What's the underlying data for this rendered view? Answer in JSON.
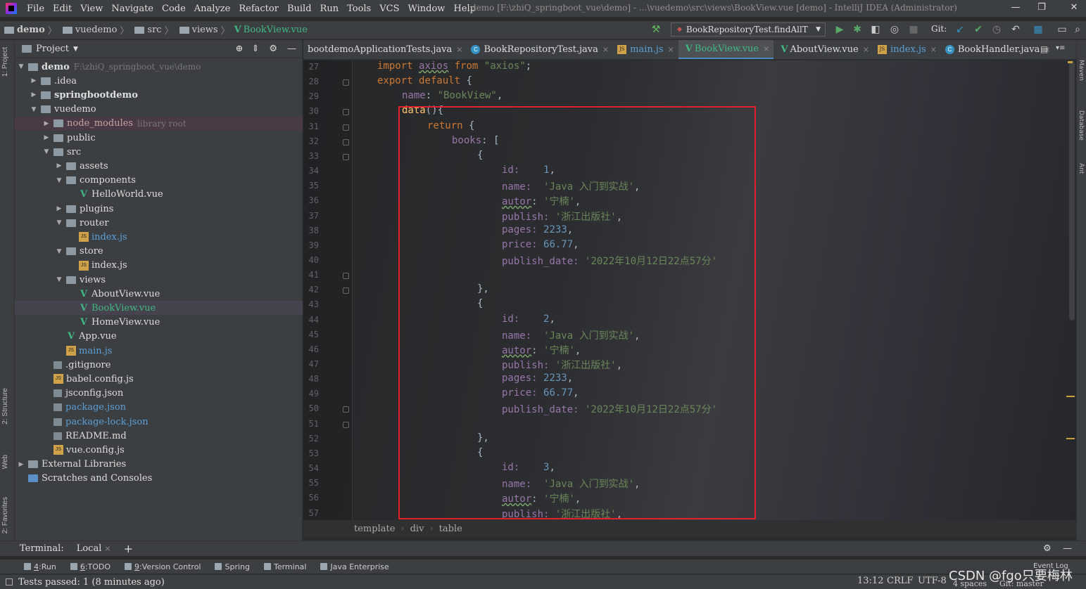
{
  "menu": [
    "File",
    "Edit",
    "View",
    "Navigate",
    "Code",
    "Analyze",
    "Refactor",
    "Build",
    "Run",
    "Tools",
    "VCS",
    "Window",
    "Help"
  ],
  "window_title": "demo [F:\\zhiQ_springboot_vue\\demo] - ...\\vuedemo\\src\\views\\BookView.vue [demo] - IntelliJ IDEA (Administrator)",
  "nav_breadcrumb": [
    "demo",
    "vuedemo",
    "src",
    "views",
    "BookView.vue"
  ],
  "run_config": "BookRepositoryTest.findAllT",
  "git_label": "Git:",
  "project_panel": {
    "title": "Project",
    "tree": [
      {
        "label": "demo",
        "note": "F:\\zhiQ_springboot_vue\\demo",
        "type": "folder",
        "arrow": "▼",
        "bold": true
      },
      {
        "label": ".idea",
        "type": "folder",
        "arrow": "▶"
      },
      {
        "label": "springbootdemo",
        "type": "folder",
        "arrow": "▶",
        "bold": true
      },
      {
        "label": "vuedemo",
        "type": "folder",
        "arrow": "▼"
      },
      {
        "label": "node_modules",
        "note": "library root",
        "type": "folder",
        "arrow": "▶"
      },
      {
        "label": "public",
        "type": "folder",
        "arrow": "▶"
      },
      {
        "label": "src",
        "type": "folder",
        "arrow": "▼"
      },
      {
        "label": "assets",
        "type": "folder",
        "arrow": "▶"
      },
      {
        "label": "components",
        "type": "folder",
        "arrow": "▼"
      },
      {
        "label": "HelloWorld.vue",
        "type": "vue"
      },
      {
        "label": "plugins",
        "type": "folder",
        "arrow": "▶"
      },
      {
        "label": "router",
        "type": "folder",
        "arrow": "▼"
      },
      {
        "label": "index.js",
        "type": "js"
      },
      {
        "label": "store",
        "type": "folder",
        "arrow": "▼"
      },
      {
        "label": "index.js",
        "type": "js"
      },
      {
        "label": "views",
        "type": "folder",
        "arrow": "▼"
      },
      {
        "label": "AboutView.vue",
        "type": "vue"
      },
      {
        "label": "BookView.vue",
        "type": "vue"
      },
      {
        "label": "HomeView.vue",
        "type": "vue"
      },
      {
        "label": "App.vue",
        "type": "vue"
      },
      {
        "label": "main.js",
        "type": "js"
      },
      {
        "label": ".gitignore",
        "type": "file"
      },
      {
        "label": "babel.config.js",
        "type": "js"
      },
      {
        "label": "jsconfig.json",
        "type": "file"
      },
      {
        "label": "package.json",
        "type": "file"
      },
      {
        "label": "package-lock.json",
        "type": "file"
      },
      {
        "label": "README.md",
        "type": "file"
      },
      {
        "label": "vue.config.js",
        "type": "js"
      },
      {
        "label": "External Libraries",
        "type": "lib",
        "arrow": "▶"
      },
      {
        "label": "Scratches and Consoles",
        "type": "scratch"
      }
    ]
  },
  "editor_tabs": [
    {
      "label": "bootdemoApplicationTests.java",
      "kind": "java"
    },
    {
      "label": "BookRepositoryTest.java",
      "kind": "java"
    },
    {
      "label": "main.js",
      "kind": "js"
    },
    {
      "label": "BookView.vue",
      "kind": "vue",
      "active": true
    },
    {
      "label": "AboutView.vue",
      "kind": "vue"
    },
    {
      "label": "index.js",
      "kind": "js"
    },
    {
      "label": "BookHandler.java",
      "kind": "java"
    }
  ],
  "line_numbers": [
    "27",
    "28",
    "29",
    "30",
    "31",
    "32",
    "33",
    "34",
    "35",
    "36",
    "37",
    "38",
    "39",
    "40",
    "41",
    "42",
    "43",
    "44",
    "45",
    "46",
    "47",
    "48",
    "49",
    "50",
    "51",
    "52",
    "53",
    "54",
    "55",
    "56",
    "57"
  ],
  "code": {
    "l27": {
      "kw1": "import",
      "var": "axios",
      "kw2": "from",
      "str": "\"axios\"",
      "tail": ";"
    },
    "l28": {
      "kw1": "export",
      "kw2": "default",
      "tail": "{"
    },
    "l29": {
      "key": "name",
      "str": "\"BookView\"",
      "tail": ","
    },
    "l30": {
      "fn": "data",
      "tail": "(){"
    },
    "l31": {
      "kw": "return",
      "tail": "{"
    },
    "l32": {
      "key": "books",
      "tail": "["
    },
    "obj_open": "{",
    "obj_close_comma": "},",
    "book": {
      "id_key": "id:",
      "name_key": "name:",
      "autor_key": "autor",
      "publish_key": "publish:",
      "pages_key": "pages:",
      "price_key": "price:",
      "date_key": "publish_date:",
      "name_val": "'Java 入门到实战'",
      "autor_val": "'宁楠'",
      "publish_val": "'浙江出版社'",
      "pages_val": "2233",
      "price_val": "66.77",
      "date_val": "'2022年10月12日22点57分'"
    },
    "ids": [
      "1",
      "2",
      "3"
    ]
  },
  "bottom_breadcrumb": [
    "template",
    "div",
    "table"
  ],
  "terminal": {
    "label": "Terminal:",
    "tab": "Local"
  },
  "tool_windows": [
    {
      "key": "4",
      "label": "Run"
    },
    {
      "key": "6",
      "label": "TODO"
    },
    {
      "key": "9",
      "label": "Version Control"
    },
    {
      "key": "",
      "label": "Spring"
    },
    {
      "key": "",
      "label": "Terminal"
    },
    {
      "key": "",
      "label": "Java Enterprise"
    }
  ],
  "status": {
    "message": "Tests passed: 1 (8 minutes ago)",
    "position": "13:12",
    "line_sep": "CRLF",
    "encoding": "UTF-8",
    "indent": "4 spaces",
    "git": "Git: master",
    "event_log": "Event Log"
  },
  "left_stripe_tabs": [
    "1: Project",
    "2: Structure",
    "Web",
    "2: Favorites"
  ],
  "right_stripe_tabs": [
    "Maven",
    "Database",
    "Ant"
  ],
  "watermark": "CSDN @fgo只要梅林"
}
